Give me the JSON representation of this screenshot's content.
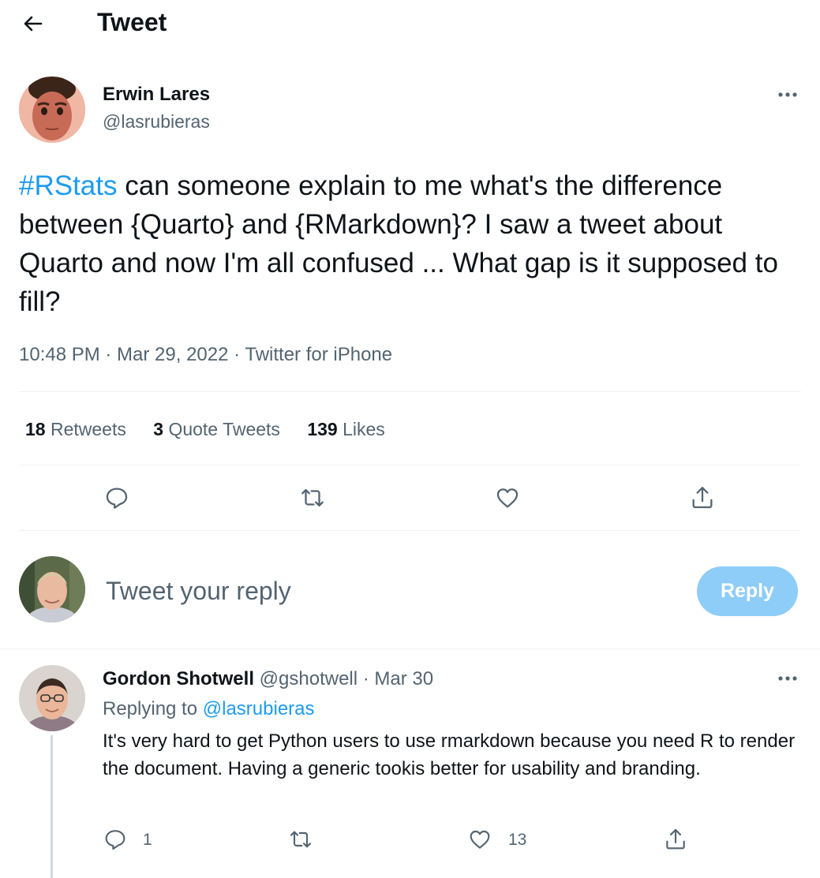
{
  "header": {
    "title": "Tweet"
  },
  "tweet": {
    "author_name": "Erwin Lares",
    "author_handle": "@lasrubieras",
    "hashtag": "#RStats",
    "text": " can someone explain to me what's the difference between {Quarto} and {RMarkdown}? I saw a tweet about Quarto and now I'm all confused ... What gap is it supposed to fill?",
    "timestamp": "10:48 PM · Mar 29, 2022 · Twitter for iPhone",
    "stats": {
      "retweets_count": "18",
      "retweets_label": "Retweets",
      "quotes_count": "3",
      "quotes_label": "Quote Tweets",
      "likes_count": "139",
      "likes_label": "Likes"
    }
  },
  "composer": {
    "placeholder": "Tweet your reply",
    "reply_button": "Reply"
  },
  "reply": {
    "author_name": "Gordon Shotwell",
    "author_handle": "@gshotwell",
    "date": "· Mar 30",
    "replying_prefix": "Replying to",
    "replying_handle": "@lasrubieras",
    "text": "It's very hard to get Python users to use rmarkdown because you need R to render the document. Having a generic tookis better for usability and branding.",
    "reply_count": "1",
    "like_count": "13"
  },
  "colors": {
    "accent": "#1d9bf0",
    "reply_button_bg": "#8ecdf8",
    "muted": "#536471"
  },
  "icons": [
    "back-arrow-icon",
    "more-icon",
    "reply-icon",
    "retweet-icon",
    "like-icon",
    "share-icon"
  ]
}
